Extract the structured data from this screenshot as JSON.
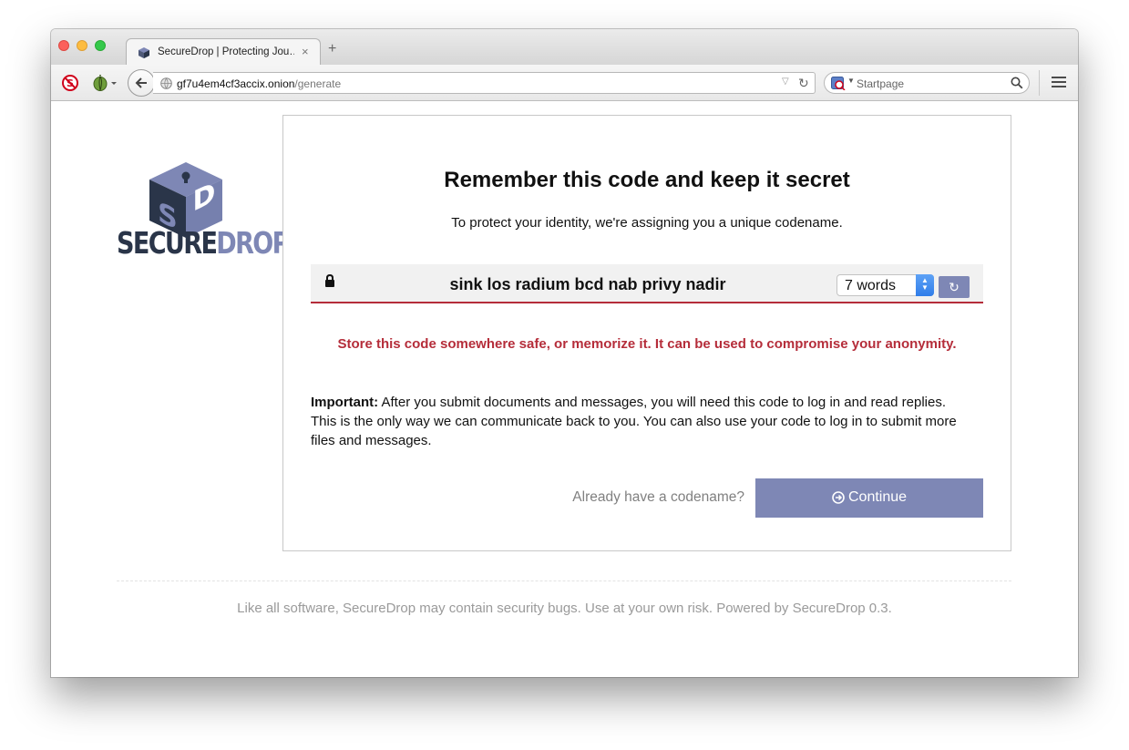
{
  "browser": {
    "tab_title": "SecureDrop | Protecting Jou…",
    "tab_close": "×",
    "new_tab": "+",
    "url_host": "gf7u4em4cf3accix.onion",
    "url_path": "/generate",
    "search_placeholder": "Startpage",
    "search_engine_icon": "startpage-icon",
    "menu_icon": "hamburger-menu-icon"
  },
  "logo": {
    "text_part1": "SECURE",
    "text_part2": "DROP",
    "colors": {
      "dark": "#2a3549",
      "light": "#7e87b5"
    }
  },
  "main": {
    "title": "Remember this code and keep it secret",
    "subtitle": "To protect your identity, we're assigning you a unique codename.",
    "codename": "sink los radium bcd nab privy nadir",
    "words_selected": "7 words",
    "warning": "Store this code somewhere safe, or memorize it. It can be used to compromise your anonymity.",
    "important_label": "Important:",
    "important_text": " After you submit documents and messages, you will need this code to log in and read replies. This is the only way we can communicate back to you. You can also use your code to log in to submit more files and messages.",
    "already_have": "Already have a codename?",
    "continue_label": "Continue"
  },
  "footer": {
    "text": "Like all software, SecureDrop may contain security bugs. Use at your own risk. Powered by SecureDrop 0.3."
  },
  "colors": {
    "accent": "#7e87b5",
    "warning": "#b52d3a",
    "select_spinner": "#2f7de9"
  }
}
